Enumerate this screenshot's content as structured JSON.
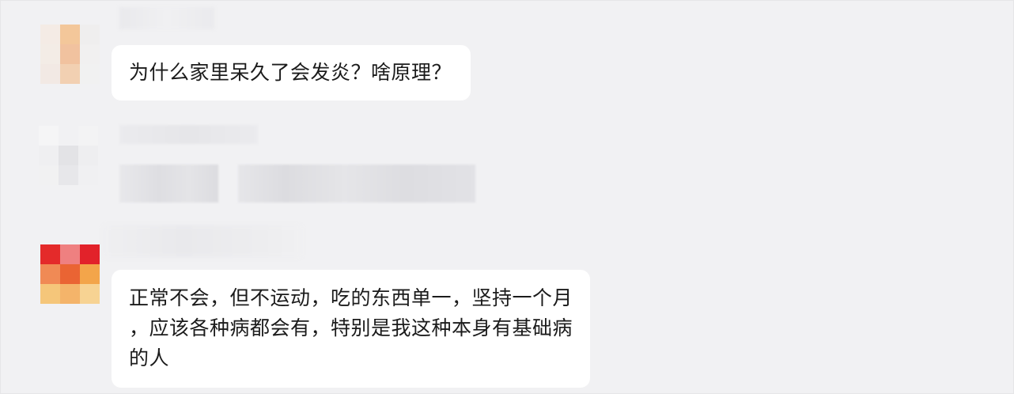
{
  "messages": [
    {
      "text_lines": [
        "为什么家里呆久了会发炎？啥原理？"
      ]
    },
    {
      "text_lines": [
        "正常不会，但不运动，吃的东西单一，坚持一个月",
        "，应该各种病都会有，特别是我这种本身有基础病",
        "的人"
      ]
    }
  ],
  "colors": {
    "background": "#f1f1f3",
    "bubble": "#ffffff",
    "text": "#1b1b1b"
  }
}
